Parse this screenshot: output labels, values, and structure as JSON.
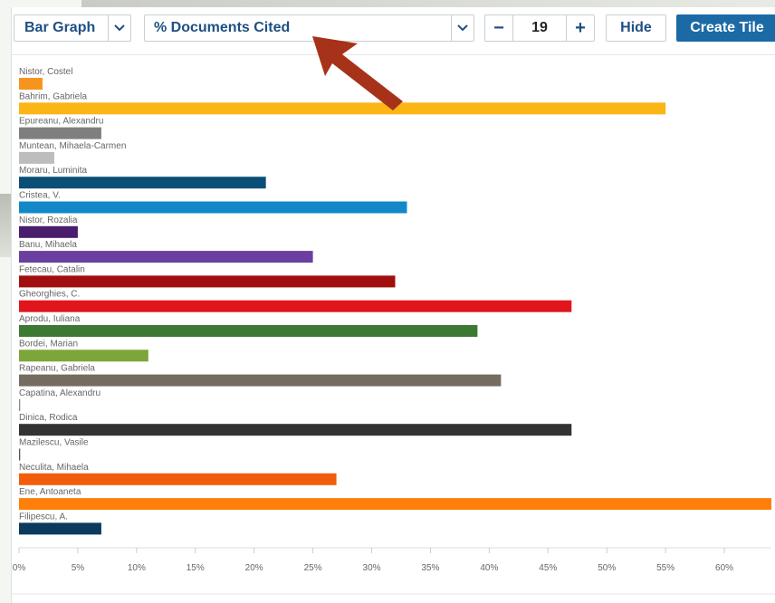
{
  "toolbar": {
    "chart_type": "Bar Graph",
    "metric": "% Documents Cited",
    "count": "19",
    "minus_symbol": "−",
    "plus_symbol": "+",
    "hide_label": "Hide",
    "create_label": "Create Tile"
  },
  "colors": {
    "accent": "#1c6aa5",
    "arrow": "#a7321a"
  },
  "chart_data": {
    "type": "bar",
    "orientation": "horizontal",
    "title": "",
    "xlabel": "",
    "ylabel": "",
    "xlim": [
      0,
      64
    ],
    "x_ticks": [
      "0%",
      "5%",
      "10%",
      "15%",
      "20%",
      "25%",
      "30%",
      "35%",
      "40%",
      "45%",
      "50%",
      "55%",
      "60%"
    ],
    "x_tick_values": [
      0,
      5,
      10,
      15,
      20,
      25,
      30,
      35,
      40,
      45,
      50,
      55,
      60
    ],
    "categories": [
      "Nistor, Costel",
      "Bahrim, Gabriela",
      "Epureanu, Alexandru",
      "Muntean, Mihaela-Carmen",
      "Moraru, Luminita",
      "Cristea, V.",
      "Nistor, Rozalia",
      "Banu, Mihaela",
      "Fetecau, Catalin",
      "Gheorghies, C.",
      "Aprodu, Iuliana",
      "Bordei, Marian",
      "Rapeanu, Gabriela",
      "Capatina, Alexandru",
      "Dinica, Rodica",
      "Mazilescu, Vasile",
      "Neculita, Mihaela",
      "Ene, Antoaneta",
      "Filipescu, A."
    ],
    "values": [
      2,
      55,
      7,
      3,
      21,
      33,
      5,
      25,
      32,
      47,
      39,
      11,
      41,
      0.1,
      47,
      0.1,
      27,
      64,
      7
    ],
    "colors": [
      "#f7941d",
      "#fbb514",
      "#7f7f7f",
      "#bdbdbd",
      "#0b4f77",
      "#1388c8",
      "#4a1e6e",
      "#6b3fa0",
      "#a10e0e",
      "#e0161c",
      "#3c7a34",
      "#7da63a",
      "#756c60",
      "#8a8a8a",
      "#333333",
      "#555555",
      "#f25c0b",
      "#ff7f0a",
      "#0a3a5c"
    ],
    "grid": false,
    "legend": "none"
  }
}
